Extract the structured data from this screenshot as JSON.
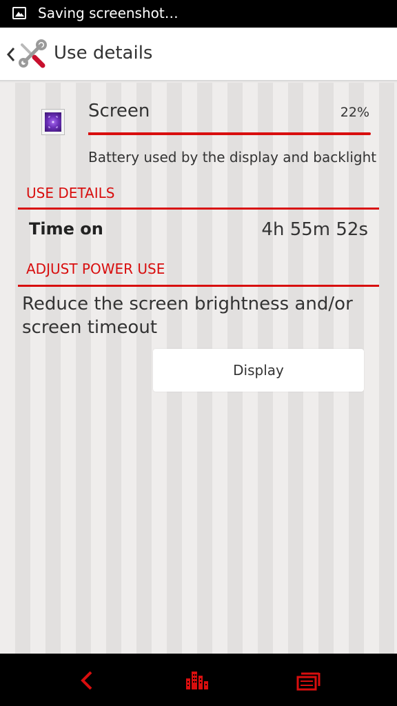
{
  "status_bar": {
    "notification_text": "Saving screenshot…",
    "notification_icon": "image-icon"
  },
  "action_bar": {
    "title": "Use details",
    "app_icon": "tools-icon"
  },
  "item": {
    "title": "Screen",
    "percent_label": "22%",
    "percent_value": 22,
    "description": "Battery used by the display and backlight",
    "icon": "screen-app-icon"
  },
  "use_details": {
    "header": "USE DETAILS",
    "time_on_label": "Time on",
    "time_on_value": "4h 55m 52s"
  },
  "adjust_power": {
    "header": "ADJUST POWER USE",
    "description": "Reduce the screen brightness and/or screen timeout",
    "button_label": "Display"
  },
  "nav_bar": {
    "back_icon": "back-icon",
    "home_icon": "home-icon",
    "recents_icon": "recents-icon"
  },
  "colors": {
    "accent": "#d80e0e",
    "text": "#333333",
    "status_bar": "#000000"
  }
}
